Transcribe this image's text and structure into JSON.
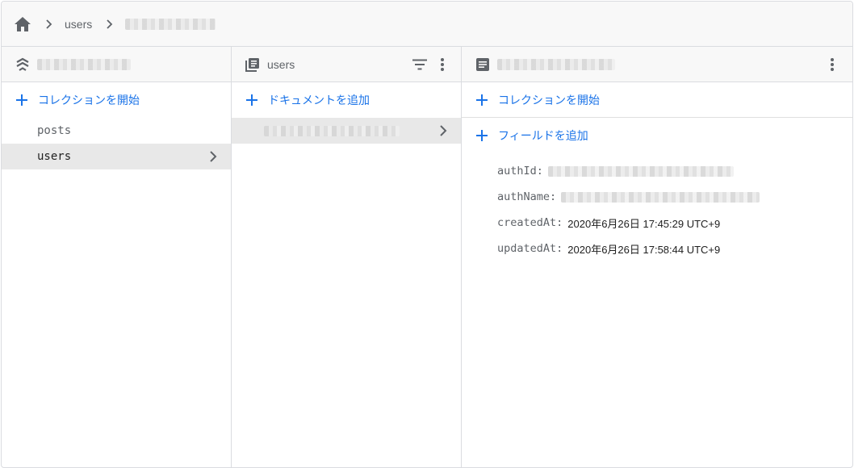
{
  "breadcrumb": {
    "home_icon": "home-icon",
    "separator_icon": "chevron-right-icon",
    "segments": [
      "users"
    ]
  },
  "columns": {
    "root": {
      "header_icon": "firestore-stack-icon",
      "add_collection_label": "コレクションを開始",
      "collections": [
        "posts",
        "users"
      ],
      "selected": "users"
    },
    "collection": {
      "header_icon": "collection-icon",
      "title": "users",
      "add_document_label": "ドキュメントを追加"
    },
    "document": {
      "header_icon": "document-icon",
      "add_collection_label": "コレクションを開始",
      "add_field_label": "フィールドを追加",
      "fields": [
        {
          "key": "authId:",
          "value": ""
        },
        {
          "key": "authName:",
          "value": ""
        },
        {
          "key": "createdAt:",
          "value": "2020年6月26日 17:45:29 UTC+9"
        },
        {
          "key": "updatedAt:",
          "value": "2020年6月26日 17:58:44 UTC+9"
        }
      ]
    }
  },
  "colors": {
    "accent": "#1a73e8",
    "header_bg": "#f8f8f8",
    "selected_bg": "#e8e8e8",
    "border": "#dadce0"
  }
}
